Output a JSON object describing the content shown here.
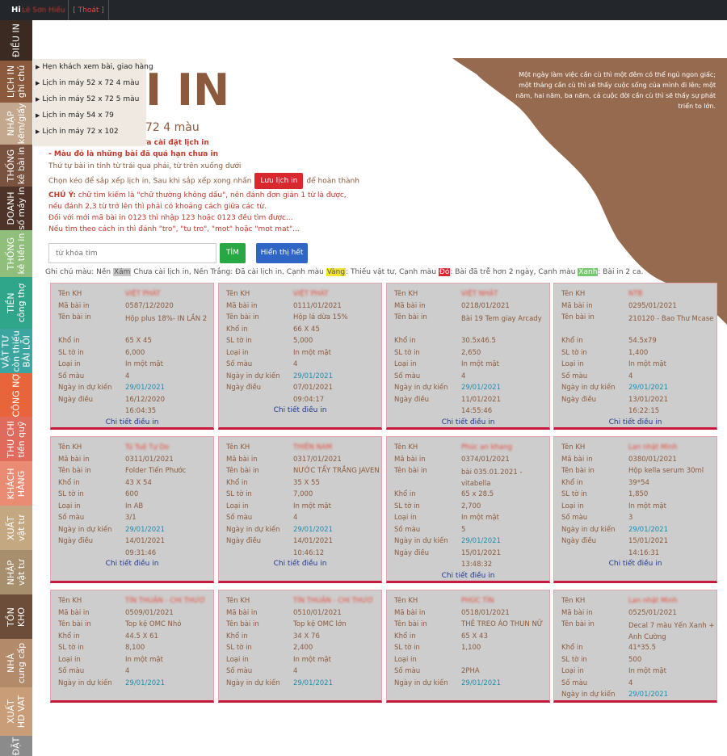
{
  "topbar": {
    "greeting": "Hi",
    "user": "Lê Sơn Hiếu",
    "logout": "[ Thoát ]"
  },
  "nav": [
    {
      "lines": [
        "ĐIỀU IN"
      ],
      "color": "#3b2a22"
    },
    {
      "lines": [
        "LỊCH IN",
        "ghi chú"
      ],
      "color": "#8b5a3c"
    },
    {
      "lines": [
        "NHẬP",
        "kẽm/giấy"
      ],
      "color": "#c4a88e"
    },
    {
      "lines": [
        "THỐNG",
        "kê bài in"
      ],
      "color": "#7a5240"
    },
    {
      "lines": [
        "DOANH",
        "số máy in"
      ],
      "color": "#4e3328"
    },
    {
      "lines": [
        "THỐNG",
        "kê tiền in"
      ],
      "color": "#8fbf7a"
    },
    {
      "lines": [
        "TIỀN",
        "công thợ"
      ],
      "color": "#2fa58a"
    },
    {
      "lines": [
        "VẬT TƯ",
        "còn thiếu",
        "BÀI LỖI"
      ],
      "color": "#3da5a0"
    },
    {
      "lines": [
        "CÔNG NỢ"
      ],
      "color": "#e8653c"
    },
    {
      "lines": [
        "THU CHI",
        "tiền quỹ"
      ],
      "color": "#e06a5b"
    },
    {
      "lines": [
        "KHÁCH",
        "HÀNG"
      ],
      "color": "#e98c73"
    },
    {
      "lines": [
        "XUẤT",
        "vật tư"
      ],
      "color": "#c4a882"
    },
    {
      "lines": [
        "NHẬP",
        "vật tư"
      ],
      "color": "#a78f6e"
    },
    {
      "lines": [
        "TỒN",
        "KHO"
      ],
      "color": "#6b4d3a"
    },
    {
      "lines": [
        "NHÀ",
        "cung cấp"
      ],
      "color": "#b38a6a"
    },
    {
      "lines": [
        "XUẤT",
        "HD VAT"
      ],
      "color": "#c89d78"
    },
    {
      "lines": [
        "ĐẶT"
      ],
      "color": "#8b8b8b"
    }
  ],
  "dropdown": [
    "Hẹn khách xem bài, giao hàng",
    "Lịch in máy 52 x 72 4 màu",
    "Lịch in máy 52 x 72 5 màu",
    "Lịch in máy 54 x 79",
    "Lịch in máy 72 x 102"
  ],
  "header": {
    "title": "I IN",
    "subtitle": "72 4 màu",
    "quote": "Một ngày làm việc cần cù thì một đêm có thể ngủ ngon giấc; một tháng cần cù thì sẽ thấy cuộc sống của mình đi lên; một năm, hai năm, ba năm, cả cuộc đời cần cù thì sẽ thấy sự phát triển to lớn."
  },
  "notes": {
    "line1": "ưa cài đặt lịch in",
    "line2": "- Màu đỏ là những bài đã quá hạn chưa in",
    "line3": "Thứ tự bài in tính từ trái qua phải, từ trên xuống dưới",
    "line4a": "Chọn kéo để sắp xếp lịch in, Sau khi sắp xếp xong nhấn",
    "save_btn": "Lưu lịch in",
    "line4b": "để hoàn thành",
    "warn_label": "CHÚ Ý:",
    "warn1": " chữ tìm kiếm là \"chữ thường không dấu\", nên đánh đơn giản 1 từ là được,",
    "warn2": "nếu đánh 2,3 từ trở lên thì phải có khoảng cách giữa các từ.",
    "warn3": "Đối với mới mã bài in 0123 thì nhập 123 hoặc 0123 đều tìm được...",
    "warn4": "Nếu tìm theo cách in thì đánh \"tro\", \"tu tro\", \"mot\" hoặc \"mot mat\"..."
  },
  "search": {
    "placeholder": "từ khóa tìm",
    "find": "TÌM",
    "show_all": "Hiển thị hết"
  },
  "legend": {
    "t1": "Ghi chú màu: Nền ",
    "gray": "Xám",
    "t2": " Chưa cài lịch in, Nền Trắng: Đã cài lịch in, Cạnh màu ",
    "yellow": "Vàng",
    "t3": ": Thiếu vật tư, Cạnh màu ",
    "red": "Đỏ",
    "t4": ": Bài đã trễ hơn 2 ngày, Cạnh màu ",
    "green": "Xanh",
    "t5": ": Bài in 2 ca."
  },
  "labels": {
    "customer": "Tên KH",
    "code": "Mã bài in",
    "name": "Tên bài in",
    "size": "Khổ in",
    "sheets": "SL tờ in",
    "type": "Loại in",
    "colors": "Số màu",
    "expected": "Ngày in dự kiến",
    "dispatch": "Ngày điều",
    "detail": "Chi tiết điều in"
  },
  "cards": [
    {
      "customer": "VIỆT PHÁT",
      "code": "0587/12/2020",
      "name": "Hộp plus 18%- IN LẦN 2",
      "size": "65 X 45",
      "sheets": "6,000",
      "type": "In một mặt",
      "colors": "4",
      "expected": "29/01/2021",
      "dispatch": "16/12/2020",
      "time": "16:04:35"
    },
    {
      "customer": "VIỆT PHÁT",
      "code": "0111/01/2021",
      "name": "Hộp lá dừa 15%",
      "size": "66 X 45",
      "sheets": "5,000",
      "type": "In một mặt",
      "colors": "4",
      "expected": "29/01/2021",
      "dispatch": "07/01/2021",
      "time": "09:04:17"
    },
    {
      "customer": "VIỆT NHẬT",
      "code": "0218/01/2021",
      "name": "Bài 19 Tem giay Arcady",
      "size": "30.5x46.5",
      "sheets": "2,650",
      "type": "In một mặt",
      "colors": "4",
      "expected": "29/01/2021",
      "dispatch": "11/01/2021",
      "time": "14:55:46"
    },
    {
      "customer": "NTB",
      "code": "0295/01/2021",
      "name": "210120 - Bao Thư Mcase",
      "size": "54.5x79",
      "sheets": "1,400",
      "type": "In một mặt",
      "colors": "4",
      "expected": "29/01/2021",
      "dispatch": "13/01/2021",
      "time": "16:22:15"
    },
    {
      "customer": "Tú Tuệ Tự Do",
      "code": "0311/01/2021",
      "name": "Folder Tiến Phước",
      "size": "43 X 54",
      "sheets": "600",
      "type": "In AB",
      "colors": "3/1",
      "expected": "29/01/2021",
      "dispatch": "14/01/2021",
      "time": "09:31:46"
    },
    {
      "customer": "THIÊN NAM",
      "code": "0317/01/2021",
      "name": "NƯỚC TẨY TRẮNG JAVEN",
      "size": "35 X 55",
      "sheets": "7,000",
      "type": "In một mặt",
      "colors": "4",
      "expected": "29/01/2021",
      "dispatch": "14/01/2021",
      "time": "10:46:12"
    },
    {
      "customer": "Phúc an khang",
      "code": "0374/01/2021",
      "name": "bài 035.01.2021 - vitabella",
      "size": "65 x 28.5",
      "sheets": "2,700",
      "type": "In một mặt",
      "colors": "5",
      "expected": "29/01/2021",
      "dispatch": "15/01/2021",
      "time": "13:48:32"
    },
    {
      "customer": "Lan nhật Minh",
      "code": "0380/01/2021",
      "name": "Hộp kella serum 30ml",
      "size": "39*54",
      "sheets": "1,850",
      "type": "In một mặt",
      "colors": "3",
      "expected": "29/01/2021",
      "dispatch": "15/01/2021",
      "time": "14:16:31"
    },
    {
      "customer": "TÍN THUẬN - CHI THƯƠ",
      "code": "0509/01/2021",
      "name": "Top kệ OMC Nhỏ",
      "size": "44.5 X 61",
      "sheets": "8,100",
      "type": "In một mặt",
      "colors": "4",
      "expected": "29/01/2021"
    },
    {
      "customer": "TÍN THUẬN - CHI THƯƠ",
      "code": "0510/01/2021",
      "name": "Top kệ OMC lớn",
      "size": "34 X 76",
      "sheets": "2,400",
      "type": "In một mặt",
      "colors": "4",
      "expected": "29/01/2021"
    },
    {
      "customer": "PHÚC TÍN",
      "code": "0518/01/2021",
      "name": "THẺ TREO ÁO THUN NỮ",
      "size": "65 X 43",
      "sheets": "1,100",
      "type": "",
      "colors": "2PHA",
      "expected": "29/01/2021"
    },
    {
      "customer": "Lan nhật Minh",
      "code": "0525/01/2021",
      "name": "Decal 7 màu Yến Xanh + Anh Cường",
      "size": "41*35.5",
      "sheets": "500",
      "type": "In một mặt",
      "colors": "4",
      "expected": "29/01/2021"
    }
  ]
}
